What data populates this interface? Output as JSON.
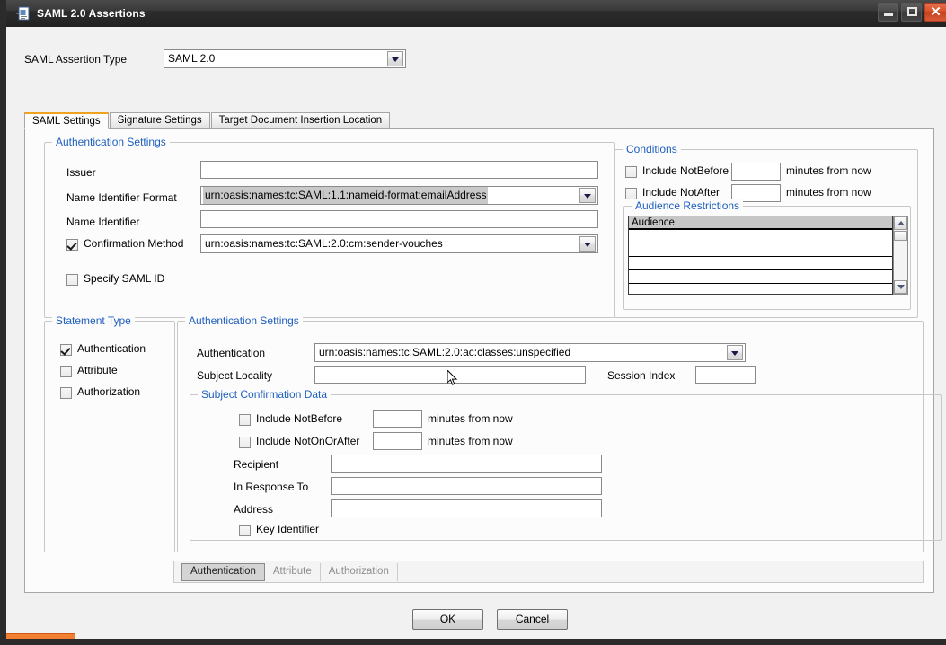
{
  "window": {
    "title": "SAML 2.0 Assertions",
    "icon": "certificate-document-icon",
    "minimize_label": "",
    "maximize_label": "",
    "close_label": "✕"
  },
  "assertion_type": {
    "label": "SAML Assertion Type",
    "value": "SAML 2.0"
  },
  "tabs": [
    {
      "label": "SAML Settings",
      "active": true
    },
    {
      "label": "Signature Settings",
      "active": false
    },
    {
      "label": "Target Document Insertion Location",
      "active": false
    }
  ],
  "authentication_settings": {
    "title": "Authentication Settings",
    "issuer_label": "Issuer",
    "issuer_value": "",
    "name_id_format_label": "Name Identifier Format",
    "name_id_format_value": "urn:oasis:names:tc:SAML:1.1:nameid-format:emailAddress",
    "name_identifier_label": "Name Identifier",
    "name_identifier_value": "",
    "confirmation_method_label": "Confirmation Method",
    "confirmation_method_checked": true,
    "confirmation_method_value": "urn:oasis:names:tc:SAML:2.0:cm:sender-vouches",
    "specify_saml_id_label": "Specify SAML ID",
    "specify_saml_id_checked": false
  },
  "conditions": {
    "title": "Conditions",
    "include_notbefore_label": "Include NotBefore",
    "include_notbefore_checked": false,
    "include_notbefore_value": "",
    "include_notbefore_suffix": "minutes from now",
    "include_notafter_label": "Include NotAfter",
    "include_notafter_checked": false,
    "include_notafter_value": "",
    "include_notafter_suffix": "minutes from now",
    "audience_restrictions": {
      "title": "Audience Restrictions",
      "column_header": "Audience",
      "rows": [
        "",
        "",
        "",
        ""
      ]
    }
  },
  "statement_type": {
    "title": "Statement Type",
    "items": [
      {
        "label": "Authentication",
        "checked": true
      },
      {
        "label": "Attribute",
        "checked": false
      },
      {
        "label": "Authorization",
        "checked": false
      }
    ]
  },
  "auth_statement": {
    "title": "Authentication Settings",
    "authentication_label": "Authentication",
    "authentication_value": "urn:oasis:names:tc:SAML:2.0:ac:classes:unspecified",
    "subject_locality_label": "Subject Locality",
    "subject_locality_value": "",
    "session_index_label": "Session Index",
    "session_index_value": "",
    "subject_confirmation_data": {
      "title": "Subject Confirmation Data",
      "include_notbefore_label": "Include NotBefore",
      "include_notbefore_checked": false,
      "include_notbefore_value": "",
      "include_notbefore_suffix": "minutes from now",
      "include_notonorafter_label": "Include NotOnOrAfter",
      "include_notonorafter_checked": false,
      "include_notonorafter_value": "",
      "include_notonorafter_suffix": "minutes from now",
      "recipient_label": "Recipient",
      "recipient_value": "",
      "in_response_to_label": "In Response To",
      "in_response_to_value": "",
      "address_label": "Address",
      "address_value": "",
      "key_identifier_label": "Key Identifier",
      "key_identifier_checked": false
    }
  },
  "bottom_tabs": [
    {
      "label": "Authentication",
      "active": true
    },
    {
      "label": "Attribute",
      "active": false
    },
    {
      "label": "Authorization",
      "active": false
    }
  ],
  "footer": {
    "ok_label": "OK",
    "cancel_label": "Cancel"
  },
  "colors": {
    "accent_tab": "#f0a31e",
    "group_title": "#1f5fbf",
    "close_button": "#d9512b",
    "selection": "#c9c9c9",
    "taskbar": "#f08030"
  }
}
